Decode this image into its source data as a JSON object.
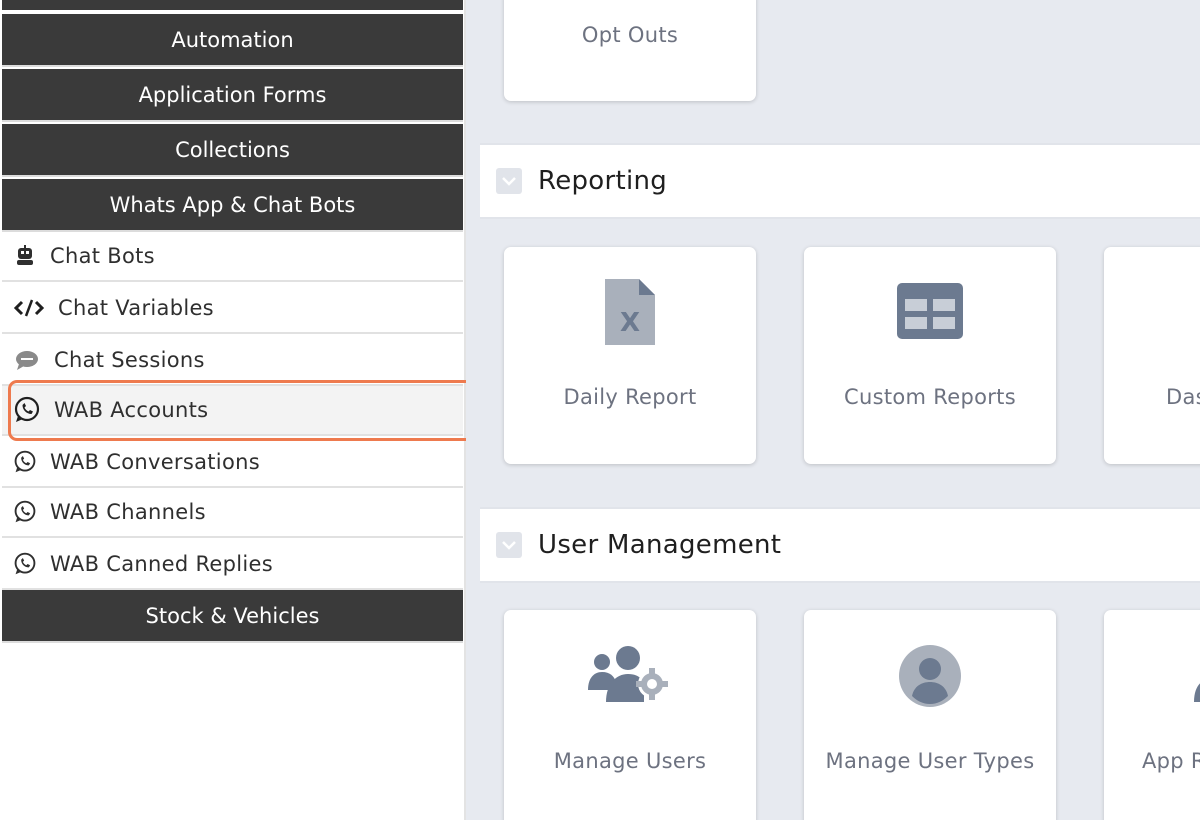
{
  "sidebar": {
    "headers": {
      "automation": "Automation",
      "application_forms": "Application Forms",
      "collections": "Collections",
      "whatsapp": "Whats App & Chat Bots",
      "stock": "Stock & Vehicles"
    },
    "items": [
      {
        "label": "Chat Bots",
        "icon": "robot-icon"
      },
      {
        "label": "Chat Variables",
        "icon": "code-icon"
      },
      {
        "label": "Chat Sessions",
        "icon": "sms-bubble-icon"
      },
      {
        "label": "WAB Accounts",
        "icon": "whatsapp-icon"
      },
      {
        "label": "WAB Conversations",
        "icon": "whatsapp-icon"
      },
      {
        "label": "WAB Channels",
        "icon": "whatsapp-icon"
      },
      {
        "label": "WAB Canned Replies",
        "icon": "whatsapp-icon"
      }
    ]
  },
  "main": {
    "top_cards": [
      {
        "label": "Opt Outs"
      }
    ],
    "reporting": {
      "title": "Reporting",
      "cards": [
        {
          "label": "Daily Report",
          "icon": "excel-file-icon"
        },
        {
          "label": "Custom Reports",
          "icon": "table-icon"
        },
        {
          "label": "Das",
          "icon": "dashboard-icon"
        }
      ]
    },
    "user_management": {
      "title": "User Management",
      "cards": [
        {
          "label": "Manage Users",
          "icon": "users-gear-icon"
        },
        {
          "label": "Manage User Types",
          "icon": "user-circle-icon"
        },
        {
          "label": "App R",
          "icon": "user-icon"
        }
      ]
    }
  },
  "colors": {
    "sidebar_header_bg": "#3a3a3a",
    "highlight": "#ee7a4e",
    "main_bg": "#e7eaf0",
    "icon_gray": "#6c7a90"
  }
}
